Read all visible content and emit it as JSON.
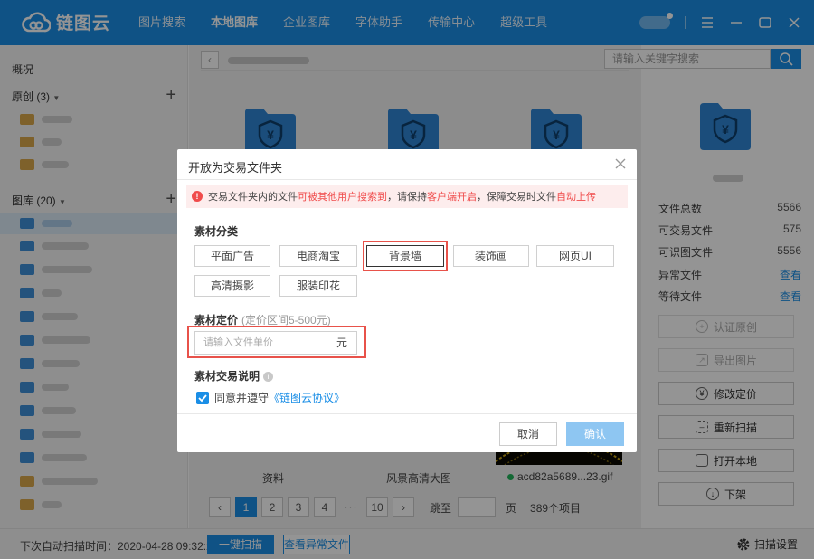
{
  "app": {
    "name": "链图云"
  },
  "nav": [
    "图片搜索",
    "本地图库",
    "企业图库",
    "字体助手",
    "传输中心",
    "超级工具"
  ],
  "sidebar": {
    "overview": "概况",
    "original": "原创 (3)",
    "library": "图库 (20)"
  },
  "search": {
    "placeholder": "请输入关键字搜索"
  },
  "content": {
    "file_names": [
      "资料",
      "风景高清大图",
      "acd82a5689...23.gif"
    ],
    "pagination": {
      "pages": [
        "1",
        "2",
        "3",
        "4",
        "10"
      ],
      "ellipsis": "···",
      "jump_label": "跳至",
      "page_unit": "页",
      "total": "389个项目"
    }
  },
  "stats": [
    {
      "label": "文件总数",
      "value": "5566"
    },
    {
      "label": "可交易文件",
      "value": "575"
    },
    {
      "label": "可识图文件",
      "value": "5556"
    },
    {
      "label": "异常文件",
      "value": "查看"
    },
    {
      "label": "等待文件",
      "value": "查看"
    }
  ],
  "actions": [
    "认证原创",
    "导出图片",
    "修改定价",
    "重新扫描",
    "打开本地",
    "下架"
  ],
  "bottom": {
    "scan_info": "下次自动扫描时间：2020-04-28 09:32:28",
    "scan_button": "一键扫描",
    "view_abnormal": "查看异常文件",
    "settings": "扫描设置"
  },
  "modal": {
    "title": "开放为交易文件夹",
    "warning": {
      "p1": "交易文件夹内的文件",
      "r1": "可被其他用户搜索到",
      "p2": "，请保持",
      "r2": "客户端开启",
      "p3": "，保障交易时文件",
      "r3": "自动上传"
    },
    "category_label": "素材分类",
    "categories": [
      "平面广告",
      "电商淘宝",
      "背景墙",
      "装饰画",
      "网页UI",
      "高清摄影",
      "服装印花"
    ],
    "price_label": "素材定价",
    "price_hint": "(定价区间5-500元)",
    "price_placeholder": "请输入文件单价",
    "price_unit": "元",
    "desc_label": "素材交易说明",
    "agree_text": "同意并遵守",
    "agree_link": "《链图云协议》",
    "cancel": "取消",
    "confirm": "确认"
  },
  "colors": {
    "primary": "#1a8ee6",
    "warning_red": "#f04b4b",
    "highlight_box": "#e8524a"
  }
}
